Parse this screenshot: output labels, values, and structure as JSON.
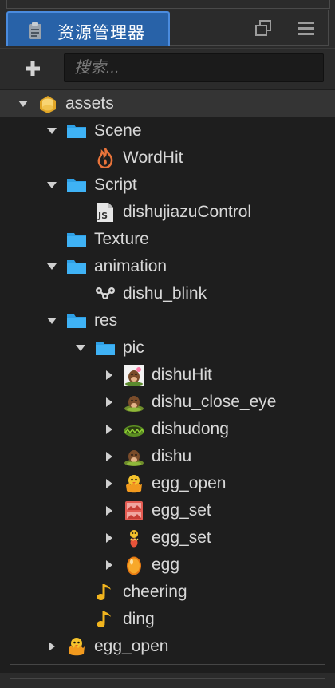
{
  "panel": {
    "title": "资源管理器"
  },
  "toolbar": {
    "add_label": "+",
    "search_placeholder": "搜索..."
  },
  "tree": [
    {
      "label": "assets",
      "icon": "assets-db-icon",
      "arrow": "down",
      "depth": 0
    },
    {
      "label": "Scene",
      "icon": "folder-icon",
      "arrow": "down",
      "depth": 1
    },
    {
      "label": "WordHit",
      "icon": "fire-scene-icon",
      "arrow": "none",
      "depth": 2
    },
    {
      "label": "Script",
      "icon": "folder-icon",
      "arrow": "down",
      "depth": 1
    },
    {
      "label": "dishujiazuControl",
      "icon": "js-file-icon",
      "arrow": "none",
      "depth": 2
    },
    {
      "label": "Texture",
      "icon": "folder-icon",
      "arrow": "none",
      "depth": 1
    },
    {
      "label": "animation",
      "icon": "folder-icon",
      "arrow": "down",
      "depth": 1
    },
    {
      "label": "dishu_blink",
      "icon": "animation-clip-icon",
      "arrow": "none",
      "depth": 2
    },
    {
      "label": "res",
      "icon": "folder-icon",
      "arrow": "down",
      "depth": 1
    },
    {
      "label": "pic",
      "icon": "folder-icon",
      "arrow": "down",
      "depth": 2
    },
    {
      "label": "dishuHit",
      "icon": "mole-hit-image-icon",
      "arrow": "right",
      "depth": 3
    },
    {
      "label": "dishu_close_eye",
      "icon": "mole-image-icon",
      "arrow": "right",
      "depth": 3
    },
    {
      "label": "dishudong",
      "icon": "hole-image-icon",
      "arrow": "right",
      "depth": 3
    },
    {
      "label": "dishu",
      "icon": "mole-image-icon",
      "arrow": "right",
      "depth": 3
    },
    {
      "label": "egg_open",
      "icon": "chick-image-icon",
      "arrow": "right",
      "depth": 3
    },
    {
      "label": "egg_set",
      "icon": "sprite-sheet-icon",
      "arrow": "right",
      "depth": 3
    },
    {
      "label": "egg_set",
      "icon": "small-chick-image-icon",
      "arrow": "right",
      "depth": 3
    },
    {
      "label": "egg",
      "icon": "egg-image-icon",
      "arrow": "right",
      "depth": 3
    },
    {
      "label": "cheering",
      "icon": "audio-note-icon",
      "arrow": "none",
      "depth": 2
    },
    {
      "label": "ding",
      "icon": "audio-note-icon",
      "arrow": "none",
      "depth": 2
    },
    {
      "label": "egg_open",
      "icon": "chick-image-icon",
      "arrow": "right",
      "depth": 1
    }
  ]
}
